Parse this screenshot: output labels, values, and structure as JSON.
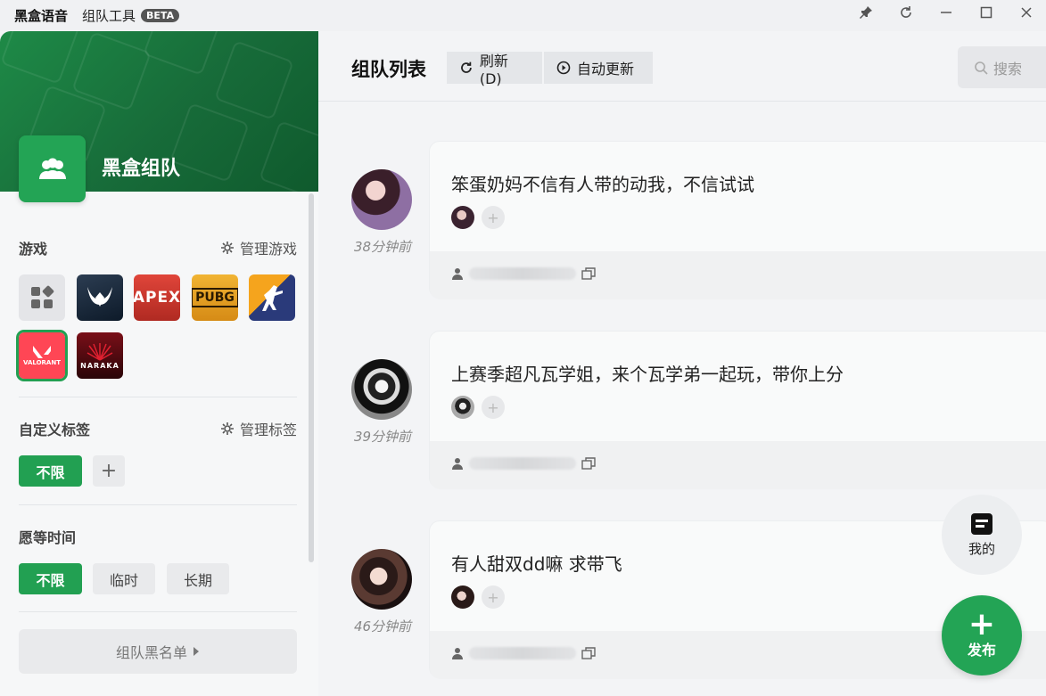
{
  "titlebar": {
    "app_name": "黑盒语音",
    "tool_name": "组队工具",
    "beta_badge": "BETA"
  },
  "sidebar": {
    "team_title": "黑盒组队",
    "games": {
      "section_title": "游戏",
      "manage_label": "管理游戏",
      "items": [
        {
          "name": "all-games",
          "label": ""
        },
        {
          "name": "destiny",
          "label": ""
        },
        {
          "name": "apex",
          "label": "APEX"
        },
        {
          "name": "pubg",
          "label": "PUBG"
        },
        {
          "name": "csgo",
          "label": ""
        },
        {
          "name": "valorant",
          "label": "VALORANT",
          "selected": true
        },
        {
          "name": "naraka",
          "label": "NARAKA"
        }
      ]
    },
    "tags": {
      "section_title": "自定义标签",
      "manage_label": "管理标签",
      "unlimited": "不限",
      "add": "+"
    },
    "wait_time": {
      "section_title": "愿等时间",
      "options": [
        "不限",
        "临时",
        "长期"
      ]
    },
    "blacklist_label": "组队黑名单"
  },
  "main": {
    "title": "组队列表",
    "refresh_label": "刷新(D)",
    "auto_update_label": "自动更新",
    "search_placeholder": "搜索",
    "posts": [
      {
        "time": "38分钟前",
        "text": "笨蛋奶妈不信有人带的动我，不信试试"
      },
      {
        "time": "39分钟前",
        "text": "上赛季超凡瓦学姐，来个瓦学弟一起玩，带你上分"
      },
      {
        "time": "46分钟前",
        "text": "有人甜双dd嘛 求带飞"
      }
    ],
    "mine_label": "我的",
    "publish_label": "发布"
  },
  "colors": {
    "accent": "#23a455",
    "banner": "#176b39"
  }
}
